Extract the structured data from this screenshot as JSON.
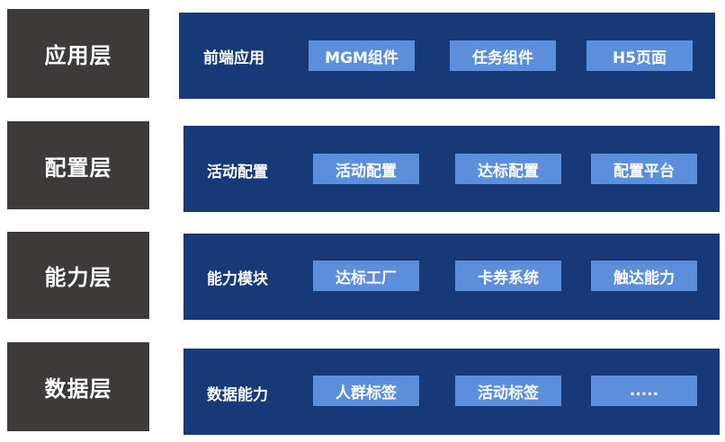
{
  "layers": [
    {
      "name": "应用层",
      "module": "前端应用",
      "items": [
        "MGM组件",
        "任务组件",
        "H5页面"
      ]
    },
    {
      "name": "配置层",
      "module": "活动配置",
      "items": [
        "活动配置",
        "达标配置",
        "配置平台"
      ]
    },
    {
      "name": "能力层",
      "module": "能力模块",
      "items": [
        "达标工厂",
        "卡券系统",
        "触达能力"
      ]
    },
    {
      "name": "数据层",
      "module": "数据能力",
      "items": [
        "人群标签",
        "活动标签",
        "....."
      ]
    }
  ],
  "colors": {
    "label_box": "#3d3a39",
    "panel": "#163a78",
    "chip": "#5b8fdb"
  }
}
